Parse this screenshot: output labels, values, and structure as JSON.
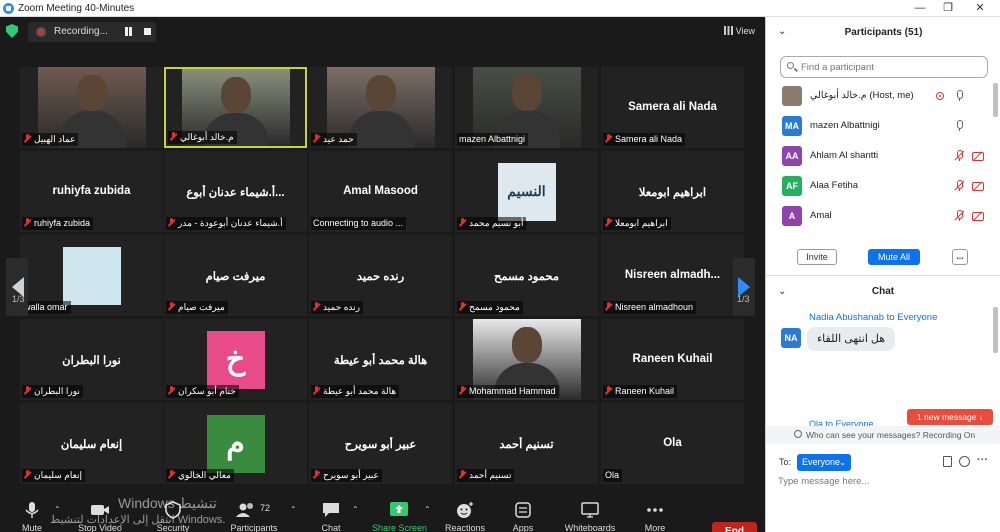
{
  "window": {
    "title": "Zoom Meeting 40-Minutes",
    "controls": [
      "minimize",
      "restore",
      "close"
    ]
  },
  "recording": {
    "label": "Recording..."
  },
  "view_label": "View",
  "pager": {
    "page": "1/3"
  },
  "tiles": [
    {
      "big": "",
      "label": "عماد الهبيل",
      "muted": true,
      "media": "photo",
      "photo_bg": "#6e5a4f"
    },
    {
      "big": "",
      "label": "م.خالد أبوغالي",
      "muted": true,
      "media": "photo",
      "photo_bg": "#8a8f7c",
      "active": true
    },
    {
      "big": "",
      "label": "حمد عيد",
      "muted": true,
      "media": "photo",
      "photo_bg": "#7d6e66"
    },
    {
      "big": "",
      "label": "mazen Albattnigi",
      "muted": false,
      "media": "photo",
      "photo_bg": "#4a4e45"
    },
    {
      "big": "Samera ali Nada",
      "label": "Samera ali Nada",
      "muted": true
    },
    {
      "big": "ruhiyfa zubida",
      "label": "ruhiyfa zubida",
      "muted": true
    },
    {
      "big": "أ.شيماء عدنان أبوع...",
      "label": "أ.شيماء عدنان أبوعودة - مدر",
      "muted": true
    },
    {
      "big": "Amal Masood",
      "label": "Connecting to audio ...",
      "muted": false
    },
    {
      "big": "",
      "label": "أبو نسيم محمد",
      "muted": true,
      "media": "avatar",
      "avatar_text": "النسيم",
      "avatar_bg": "#dfe8ee"
    },
    {
      "big": "ابراهيم ابومعلا",
      "label": "ابراهيم ابومعلا",
      "muted": true
    },
    {
      "big": "",
      "label": "walla omar",
      "muted": false,
      "media": "avatar",
      "avatar_text": "",
      "avatar_bg": "#cfe6ef"
    },
    {
      "big": "ميرفت صيام",
      "label": "ميرفت صيام",
      "muted": true
    },
    {
      "big": "رنده حميد",
      "label": "رنده حميد",
      "muted": true
    },
    {
      "big": "محمود مسمح",
      "label": "محمود مسمح",
      "muted": true
    },
    {
      "big": "Nisreen almadh...",
      "label": "Nisreen almadhoun",
      "muted": true
    },
    {
      "big": "نورا البطران",
      "label": "نورا البطران",
      "muted": true
    },
    {
      "big": "",
      "label": "ختام أبو سكران",
      "muted": true,
      "media": "avatar",
      "avatar_text": "خ",
      "avatar_bg": "#e84a8a"
    },
    {
      "big": "هالة محمد أبو عيطة",
      "label": "هالة محمد أبو عيطة",
      "muted": true
    },
    {
      "big": "",
      "label": "Mohammad Hammad",
      "muted": true,
      "media": "photo",
      "photo_bg": "#e9e9e9"
    },
    {
      "big": "Raneen Kuhail",
      "label": "Raneen Kuhail",
      "muted": true
    },
    {
      "big": "إنعام سليمان",
      "label": "إنعام سليمان",
      "muted": true
    },
    {
      "big": "",
      "label": "معالي الخالوي",
      "muted": true,
      "media": "avatar",
      "avatar_text": "م",
      "avatar_bg": "#3a8a3f"
    },
    {
      "big": "عبير أبو سويرح",
      "label": "عبير أبو سويرح",
      "muted": true
    },
    {
      "big": "تسنيم أحمد",
      "label": "تسنيم أحمد",
      "muted": true
    },
    {
      "big": "Ola",
      "label": "Ola",
      "muted": false
    }
  ],
  "toolbar": {
    "mute": "Mute",
    "stop_video": "Stop Video",
    "security": "Security",
    "participants": "Participants",
    "participants_count": "72",
    "chat": "Chat",
    "share_screen": "Share Screen",
    "reactions": "Reactions",
    "apps": "Apps",
    "whiteboards": "Whiteboards",
    "more": "More",
    "end": "End"
  },
  "watermark": {
    "line1": "Windows تنشيط",
    "line2": "انتقل إلى الإعدادات لتنشيط Windows."
  },
  "participants_panel": {
    "title": "Participants (51)",
    "search_placeholder": "Find a participant",
    "rows": [
      {
        "initials": "",
        "name": "م.خالد أبوغالي (Host, me)",
        "color": "#8a7b6a",
        "recording": true,
        "mic": "on",
        "cam": "none"
      },
      {
        "initials": "MA",
        "name": "mazen Albattnigi",
        "color": "#2b7bd3",
        "recording": false,
        "mic": "on",
        "cam": "none"
      },
      {
        "initials": "AA",
        "name": "Ahlam Al shantti",
        "color": "#8e44ad",
        "recording": false,
        "mic": "muted",
        "cam": "off"
      },
      {
        "initials": "AF",
        "name": "Alaa Fetiha",
        "color": "#27ae60",
        "recording": false,
        "mic": "muted",
        "cam": "off"
      },
      {
        "initials": "A",
        "name": "Amal",
        "color": "#8e44ad",
        "recording": false,
        "mic": "muted",
        "cam": "off"
      }
    ],
    "invite": "Invite",
    "mute_all": "Mute All",
    "more": "..."
  },
  "chat_panel": {
    "title": "Chat",
    "messages": [
      {
        "initials": "NA",
        "from": "Nadia Abushanab",
        "to_word": "to",
        "to": "Everyone",
        "text": "هل انتهى اللقاء"
      }
    ],
    "partial_sender": "Ola to Everyone",
    "new_messages": "1 new message ↓",
    "who_can_see": "Who can see your messages? Recording On",
    "to_label": "To:",
    "to_value": "Everyone",
    "placeholder": "Type message here..."
  }
}
